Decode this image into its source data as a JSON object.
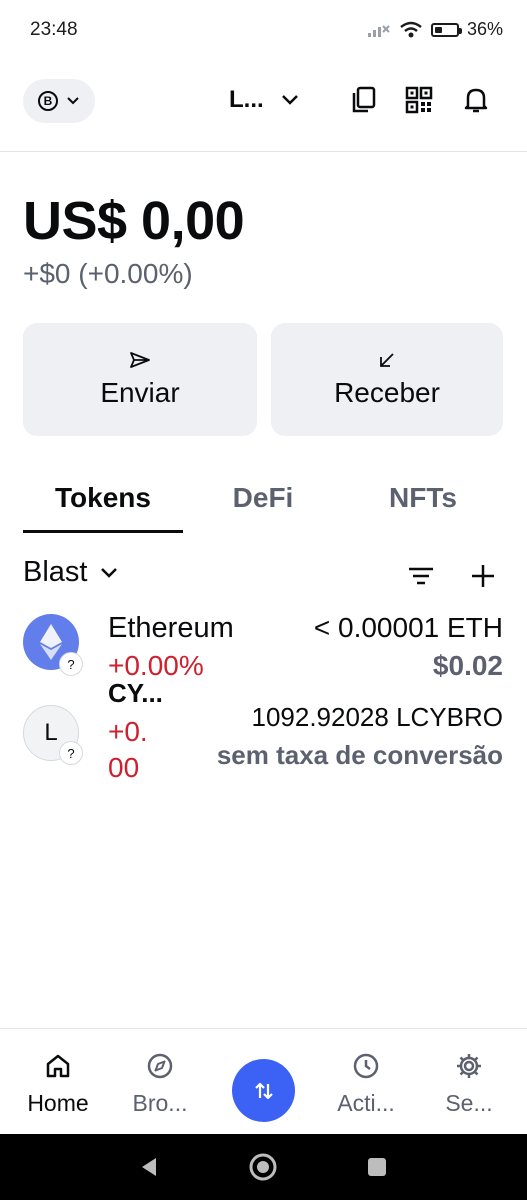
{
  "status_bar": {
    "time": "23:48",
    "battery": "36%",
    "battery_level": 0.36
  },
  "header": {
    "account_initial": "B",
    "wallet_name": "L..."
  },
  "balance": {
    "total": "US$ 0,00",
    "change": "+$0 (+0.00%)"
  },
  "actions": {
    "send": "Enviar",
    "receive": "Receber"
  },
  "tabs": {
    "tokens": "Tokens",
    "defi": "DeFi",
    "nfts": "NFTs"
  },
  "network": {
    "selected": "Blast"
  },
  "assets": [
    {
      "name": "Ethereum",
      "change": "+0.00%",
      "amount": "< 0.00001 ETH",
      "fiat": "$0.02",
      "badge": "?"
    },
    {
      "initial": "L",
      "name_line1": "CY...",
      "change_line1": "+0.",
      "change_line2": "00",
      "amount": "1092.92028 LCYBRO",
      "fiat": "sem taxa de conversão",
      "badge": "?"
    }
  ],
  "bottom_nav": {
    "home": "Home",
    "browser": "Bro...",
    "activity": "Acti...",
    "settings": "Se..."
  },
  "colors": {
    "accent": "#3c62f5",
    "negative": "#cf202f",
    "muted": "#5b616e",
    "eth": "#627eea"
  }
}
